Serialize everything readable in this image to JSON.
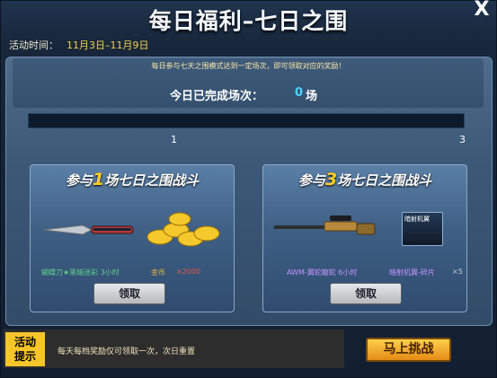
{
  "header": {
    "title": "每日福利–七日之围",
    "close_label": "X"
  },
  "event_time": {
    "label": "活动时间：",
    "value": "11月3日–11月9日"
  },
  "notice": "每日参与七天之围模式达到一定场次，即可领取对应的奖励！",
  "progress": {
    "label": "今日已完成场次：",
    "count": "0",
    "unit": "场",
    "fraction": 0,
    "tick_1": "1",
    "tick_3": "3"
  },
  "cards": [
    {
      "title_pre": "参与",
      "title_num": "1",
      "title_post": "场七日之围战斗",
      "item1": "蝴蝶刀★黑暗迷彩 3小时",
      "item2": "金币",
      "item2_qty": "×2000",
      "button": "领取"
    },
    {
      "title_pre": "参与",
      "title_num": "3",
      "title_post": "场七日之围战斗",
      "item1": "AWM-翼蛇蝮蛇 6小时",
      "item2": "暗射机翼-碎片",
      "item2_qty": "×5",
      "button": "领取",
      "wing_badge_text": "暗射机翼"
    }
  ],
  "footer": {
    "badge": "活动提示",
    "tip": "每天每档奖励仅可领取一次，次日重置",
    "go_button": "马上挑战"
  },
  "colors": {
    "accent_gold": "#f2d24a",
    "progress_blue": "#38a8e6",
    "count_cyan": "#4fd4ff"
  },
  "icons": [
    "close-icon",
    "butterfly-knife-icon",
    "gold-coins-icon",
    "awm-rifle-icon",
    "wing-fragment-icon"
  ]
}
